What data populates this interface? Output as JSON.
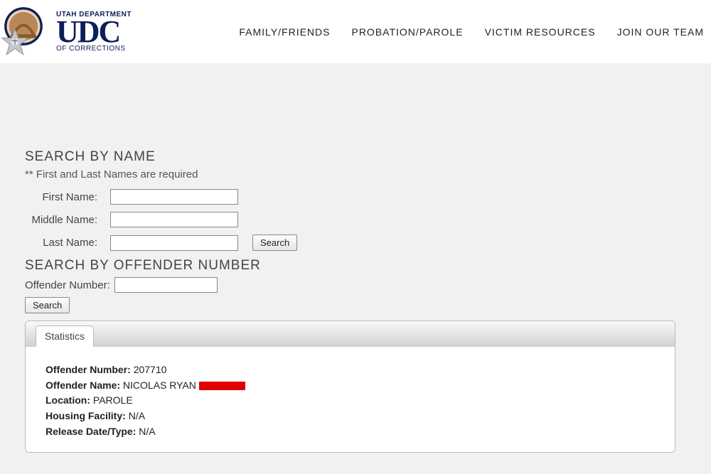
{
  "header": {
    "logo_top": "UTAH DEPARTMENT",
    "logo_main": "UDC",
    "logo_bottom": "OF CORRECTIONS",
    "nav": [
      "FAMILY/FRIENDS",
      "PROBATION/PAROLE",
      "VICTIM RESOURCES",
      "JOIN OUR TEAM"
    ]
  },
  "search_name": {
    "title": "SEARCH BY NAME",
    "hint": "** First and Last Names are required",
    "first_label": "First Name:",
    "middle_label": "Middle Name:",
    "last_label": "Last Name:",
    "first_value": "",
    "middle_value": "",
    "last_value": "",
    "search_btn": "Search"
  },
  "search_number": {
    "title": "SEARCH BY OFFENDER NUMBER",
    "label": "Offender Number:",
    "value": "",
    "search_btn": "Search"
  },
  "results": {
    "tab_label": "Statistics",
    "fields": {
      "offender_number_label": "Offender Number:",
      "offender_number_value": "207710",
      "offender_name_label": "Offender Name:",
      "offender_name_value": "NICOLAS RYAN",
      "location_label": "Location:",
      "location_value": "PAROLE",
      "housing_label": "Housing Facility:",
      "housing_value": "N/A",
      "release_label": "Release Date/Type:",
      "release_value": "N/A"
    }
  }
}
